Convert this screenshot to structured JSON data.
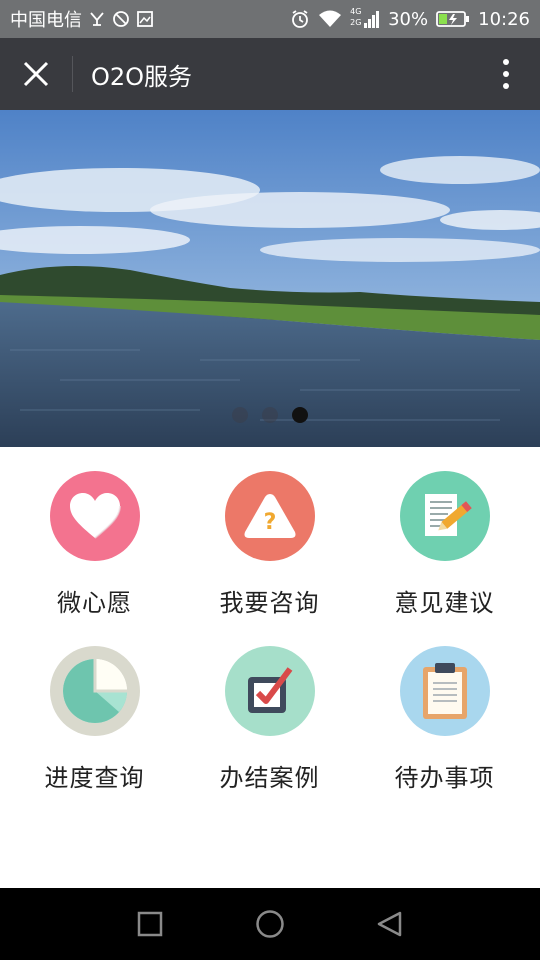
{
  "status_bar": {
    "carrier": "中国电信",
    "network": "4G",
    "network_sub": "2G",
    "battery": "30%",
    "time": "10:26"
  },
  "title_bar": {
    "title": "O2O服务"
  },
  "banner": {
    "slide_count": 3,
    "active_slide": 3
  },
  "menu": {
    "items": [
      {
        "label": "微心愿",
        "icon": "heart-icon",
        "color": "#f3738f"
      },
      {
        "label": "我要咨询",
        "icon": "warning-question-icon",
        "color": "#ec7868"
      },
      {
        "label": "意见建议",
        "icon": "document-pencil-icon",
        "color": "#6fd0b0"
      },
      {
        "label": "进度查询",
        "icon": "pie-chart-icon",
        "color": "#d9d9cd"
      },
      {
        "label": "办结案例",
        "icon": "checkbox-icon",
        "color": "#a6dfca"
      },
      {
        "label": "待办事项",
        "icon": "clipboard-icon",
        "color": "#a9d7ee"
      }
    ]
  },
  "colors": {
    "status_bar_bg": "#6f7173",
    "title_bar_bg": "#393a3f",
    "nav_bar_bg": "#000000"
  }
}
